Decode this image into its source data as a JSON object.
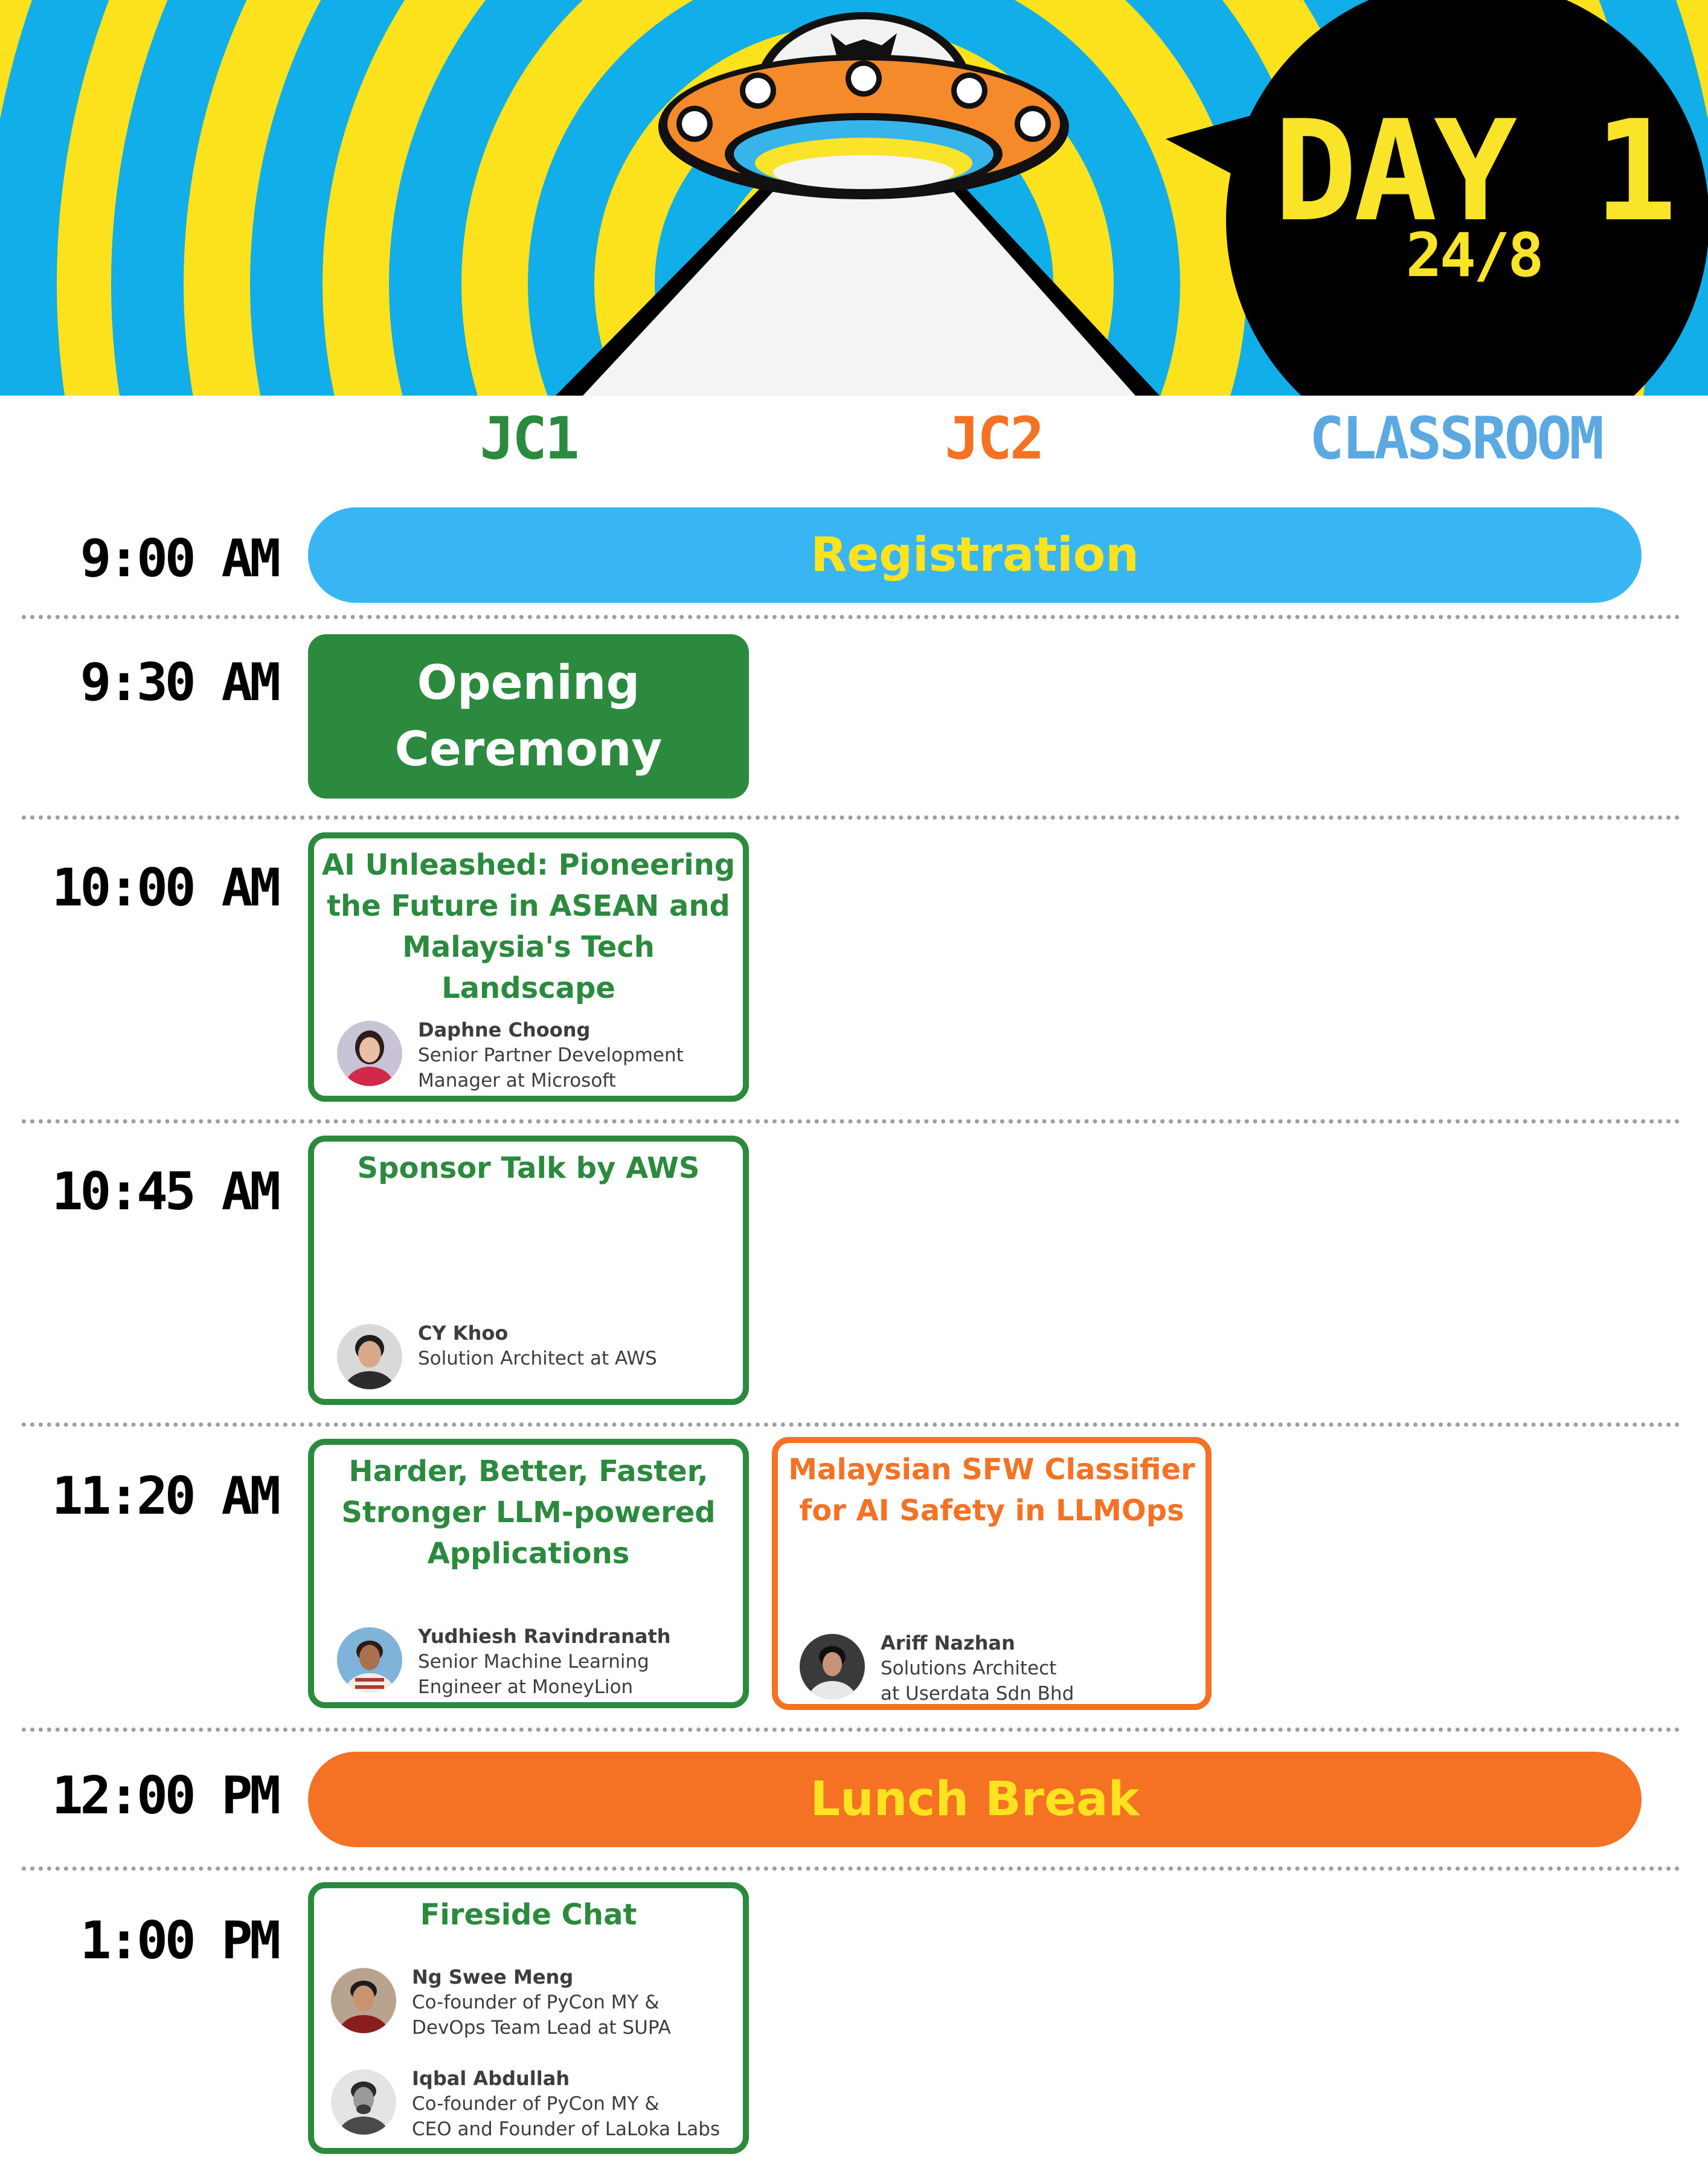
{
  "header": {
    "day": "DAY 1",
    "date": "24/8"
  },
  "columns": [
    "JC1",
    "JC2",
    "CLASSROOM"
  ],
  "colors": {
    "green": "#2b8a3e",
    "orange": "#f57224",
    "blue": "#38b6f4",
    "yellow": "#ffe321",
    "classroom_blue": "#5ba9e0"
  },
  "times": [
    "9:00 AM",
    "9:30 AM",
    "10:00 AM",
    "10:45 AM",
    "11:20 AM",
    "12:00 PM",
    "1:00 PM"
  ],
  "registration": "Registration",
  "lunch": "Lunch Break",
  "opening": {
    "line1": "Opening",
    "line2": "Ceremony"
  },
  "sessions": [
    {
      "title": [
        "AI Unleashed: Pioneering",
        "the Future in ASEAN and",
        "Malaysia's Tech",
        "Landscape"
      ],
      "speakers": [
        {
          "name": "Daphne Choong",
          "role": [
            "Senior Partner Development",
            "Manager at Microsoft"
          ],
          "avatar": "person-avatar"
        }
      ]
    },
    {
      "title": [
        "Sponsor Talk by AWS"
      ],
      "speakers": [
        {
          "name": "CY Khoo",
          "role": [
            "Solution Architect at AWS"
          ],
          "avatar": "person-avatar"
        }
      ]
    },
    {
      "title": [
        "Harder, Better, Faster,",
        "Stronger LLM-powered",
        "Applications"
      ],
      "speakers": [
        {
          "name": "Yudhiesh Ravindranath",
          "role": [
            "Senior Machine Learning",
            "Engineer at MoneyLion"
          ],
          "avatar": "person-avatar"
        }
      ]
    },
    {
      "title": [
        "Malaysian SFW Classifier",
        "for AI Safety in LLMOps"
      ],
      "speakers": [
        {
          "name": "Ariff Nazhan",
          "role": [
            "Solutions Architect",
            "at Userdata Sdn Bhd"
          ],
          "avatar": "person-avatar"
        }
      ]
    },
    {
      "title": [
        "Fireside Chat"
      ],
      "speakers": [
        {
          "name": "Ng Swee Meng",
          "role": [
            "Co-founder of PyCon MY &",
            "DevOps Team Lead at SUPA"
          ],
          "avatar": "person-avatar"
        },
        {
          "name": "Iqbal Abdullah",
          "role": [
            "Co-founder of PyCon MY &",
            "CEO and Founder of LaLoka Labs"
          ],
          "avatar": "person-avatar"
        }
      ]
    }
  ]
}
